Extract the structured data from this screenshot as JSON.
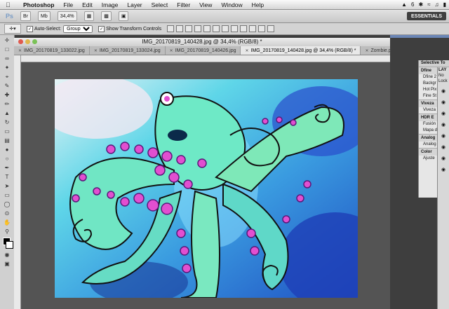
{
  "menubar": {
    "app": "Photoshop",
    "items": [
      "File",
      "Edit",
      "Image",
      "Layer",
      "Select",
      "Filter",
      "View",
      "Window",
      "Help"
    ],
    "right": [
      "6"
    ]
  },
  "appbar": {
    "logo": "Ps",
    "zoom": "34,4%",
    "workspace": "ESSENTIALS"
  },
  "options": {
    "auto_select_label": "Auto-Select:",
    "auto_select_value": "Group",
    "show_transform_label": "Show Transform Controls"
  },
  "document": {
    "title": "IMG_20170819_140428.jpg @ 34,4% (RGB/8) *",
    "tabs": [
      "IMG_20170819_133022.jpg",
      "IMG_20170819_133024.jpg",
      "IMG_20170819_140426.jpg",
      "IMG_20170819_140428.jpg @ 34,4% (RGB/8) *",
      "Zombie.psd @ 33,3"
    ]
  },
  "selective_tool": {
    "title": "Selective To",
    "sections": [
      {
        "name": "Dfine",
        "items": [
          "Dfine 2",
          "Backgr",
          "Hot Pix",
          "Fine St"
        ]
      },
      {
        "name": "Viveza",
        "items": [
          "Viveza"
        ]
      },
      {
        "name": "HDR E",
        "items": [
          "Fusión",
          "Mapa d"
        ]
      },
      {
        "name": "Analog",
        "items": [
          "Analog"
        ]
      },
      {
        "name": "Color",
        "items": [
          "Ajuste"
        ]
      }
    ]
  },
  "layers": {
    "title": "LAY",
    "label": "No",
    "lock": "Lock"
  },
  "colors": {
    "menubar": "#e6e6e6",
    "canvas": "#545454",
    "essentials": "#3f3f3f"
  }
}
